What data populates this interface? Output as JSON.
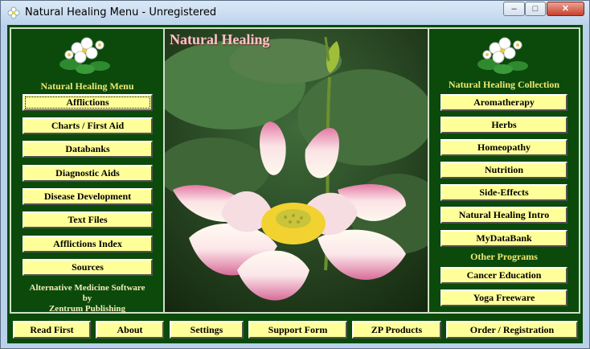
{
  "window": {
    "title": "Natural Healing Menu - Unregistered",
    "minimize": "–",
    "maximize": "□",
    "close": "✕"
  },
  "left": {
    "heading": "Natural Healing Menu",
    "buttons": [
      "Afflictions",
      "Charts / First Aid",
      "Databanks",
      "Diagnostic Aids",
      "Disease Development",
      "Text Files",
      "Afflictions Index",
      "Sources"
    ],
    "credit_line1": "Alternative Medicine Software",
    "credit_line2": "by",
    "credit_line3": "Zentrum Publishing"
  },
  "photo": {
    "title": "Natural Healing"
  },
  "right": {
    "heading": "Natural Healing Collection",
    "buttons": [
      "Aromatherapy",
      "Herbs",
      "Homeopathy",
      "Nutrition",
      "Side-Effects",
      "Natural Healing Intro",
      "MyDataBank"
    ],
    "other_heading": "Other Programs",
    "other_buttons": [
      "Cancer Education",
      "Yoga Freeware"
    ]
  },
  "bottom": {
    "buttons": [
      "Read First",
      "About",
      "Settings",
      "Support Form",
      "ZP Products",
      "Order / Registration"
    ]
  },
  "colors": {
    "panel_green": "#0b4a0b",
    "button_yellow": "#ffff99",
    "heading_yellow": "#f0e870"
  }
}
